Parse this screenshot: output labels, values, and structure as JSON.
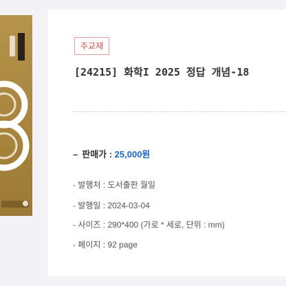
{
  "product": {
    "badge": "주교재",
    "title": "[24215] 화학I 2025 정답 개념-18",
    "price_label": "판매가 : ",
    "price": "25,000원"
  },
  "specs": [
    {
      "label": "발행처",
      "value": "도서출판 월일"
    },
    {
      "label": "발행일",
      "value": "2024-03-04"
    },
    {
      "label": "사이즈",
      "value": "290*400 (가로 * 세로, 단위 : mm)"
    },
    {
      "label": "페이지",
      "value": "92 page"
    }
  ],
  "colors": {
    "badge": "#d84c4c",
    "price": "#1e67c4",
    "cover": "#a8843c"
  }
}
